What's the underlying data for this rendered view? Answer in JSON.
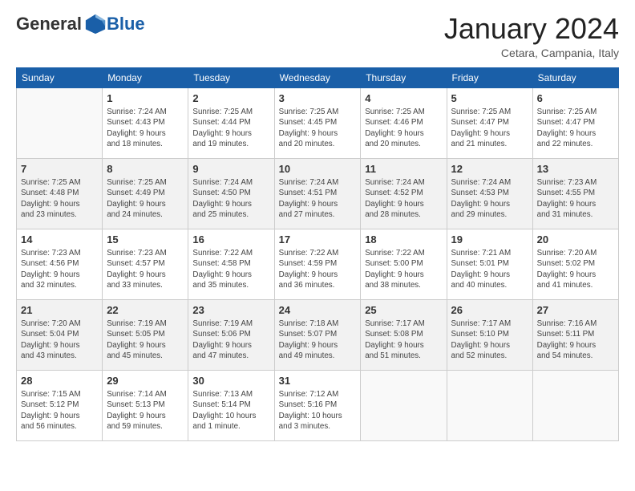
{
  "header": {
    "logo_general": "General",
    "logo_blue": "Blue",
    "month_title": "January 2024",
    "location": "Cetara, Campania, Italy"
  },
  "weekdays": [
    "Sunday",
    "Monday",
    "Tuesday",
    "Wednesday",
    "Thursday",
    "Friday",
    "Saturday"
  ],
  "rows": [
    [
      {
        "day": "",
        "info": ""
      },
      {
        "day": "1",
        "info": "Sunrise: 7:24 AM\nSunset: 4:43 PM\nDaylight: 9 hours\nand 18 minutes."
      },
      {
        "day": "2",
        "info": "Sunrise: 7:25 AM\nSunset: 4:44 PM\nDaylight: 9 hours\nand 19 minutes."
      },
      {
        "day": "3",
        "info": "Sunrise: 7:25 AM\nSunset: 4:45 PM\nDaylight: 9 hours\nand 20 minutes."
      },
      {
        "day": "4",
        "info": "Sunrise: 7:25 AM\nSunset: 4:46 PM\nDaylight: 9 hours\nand 20 minutes."
      },
      {
        "day": "5",
        "info": "Sunrise: 7:25 AM\nSunset: 4:47 PM\nDaylight: 9 hours\nand 21 minutes."
      },
      {
        "day": "6",
        "info": "Sunrise: 7:25 AM\nSunset: 4:47 PM\nDaylight: 9 hours\nand 22 minutes."
      }
    ],
    [
      {
        "day": "7",
        "info": "Sunrise: 7:25 AM\nSunset: 4:48 PM\nDaylight: 9 hours\nand 23 minutes."
      },
      {
        "day": "8",
        "info": "Sunrise: 7:25 AM\nSunset: 4:49 PM\nDaylight: 9 hours\nand 24 minutes."
      },
      {
        "day": "9",
        "info": "Sunrise: 7:24 AM\nSunset: 4:50 PM\nDaylight: 9 hours\nand 25 minutes."
      },
      {
        "day": "10",
        "info": "Sunrise: 7:24 AM\nSunset: 4:51 PM\nDaylight: 9 hours\nand 27 minutes."
      },
      {
        "day": "11",
        "info": "Sunrise: 7:24 AM\nSunset: 4:52 PM\nDaylight: 9 hours\nand 28 minutes."
      },
      {
        "day": "12",
        "info": "Sunrise: 7:24 AM\nSunset: 4:53 PM\nDaylight: 9 hours\nand 29 minutes."
      },
      {
        "day": "13",
        "info": "Sunrise: 7:23 AM\nSunset: 4:55 PM\nDaylight: 9 hours\nand 31 minutes."
      }
    ],
    [
      {
        "day": "14",
        "info": "Sunrise: 7:23 AM\nSunset: 4:56 PM\nDaylight: 9 hours\nand 32 minutes."
      },
      {
        "day": "15",
        "info": "Sunrise: 7:23 AM\nSunset: 4:57 PM\nDaylight: 9 hours\nand 33 minutes."
      },
      {
        "day": "16",
        "info": "Sunrise: 7:22 AM\nSunset: 4:58 PM\nDaylight: 9 hours\nand 35 minutes."
      },
      {
        "day": "17",
        "info": "Sunrise: 7:22 AM\nSunset: 4:59 PM\nDaylight: 9 hours\nand 36 minutes."
      },
      {
        "day": "18",
        "info": "Sunrise: 7:22 AM\nSunset: 5:00 PM\nDaylight: 9 hours\nand 38 minutes."
      },
      {
        "day": "19",
        "info": "Sunrise: 7:21 AM\nSunset: 5:01 PM\nDaylight: 9 hours\nand 40 minutes."
      },
      {
        "day": "20",
        "info": "Sunrise: 7:20 AM\nSunset: 5:02 PM\nDaylight: 9 hours\nand 41 minutes."
      }
    ],
    [
      {
        "day": "21",
        "info": "Sunrise: 7:20 AM\nSunset: 5:04 PM\nDaylight: 9 hours\nand 43 minutes."
      },
      {
        "day": "22",
        "info": "Sunrise: 7:19 AM\nSunset: 5:05 PM\nDaylight: 9 hours\nand 45 minutes."
      },
      {
        "day": "23",
        "info": "Sunrise: 7:19 AM\nSunset: 5:06 PM\nDaylight: 9 hours\nand 47 minutes."
      },
      {
        "day": "24",
        "info": "Sunrise: 7:18 AM\nSunset: 5:07 PM\nDaylight: 9 hours\nand 49 minutes."
      },
      {
        "day": "25",
        "info": "Sunrise: 7:17 AM\nSunset: 5:08 PM\nDaylight: 9 hours\nand 51 minutes."
      },
      {
        "day": "26",
        "info": "Sunrise: 7:17 AM\nSunset: 5:10 PM\nDaylight: 9 hours\nand 52 minutes."
      },
      {
        "day": "27",
        "info": "Sunrise: 7:16 AM\nSunset: 5:11 PM\nDaylight: 9 hours\nand 54 minutes."
      }
    ],
    [
      {
        "day": "28",
        "info": "Sunrise: 7:15 AM\nSunset: 5:12 PM\nDaylight: 9 hours\nand 56 minutes."
      },
      {
        "day": "29",
        "info": "Sunrise: 7:14 AM\nSunset: 5:13 PM\nDaylight: 9 hours\nand 59 minutes."
      },
      {
        "day": "30",
        "info": "Sunrise: 7:13 AM\nSunset: 5:14 PM\nDaylight: 10 hours\nand 1 minute."
      },
      {
        "day": "31",
        "info": "Sunrise: 7:12 AM\nSunset: 5:16 PM\nDaylight: 10 hours\nand 3 minutes."
      },
      {
        "day": "",
        "info": ""
      },
      {
        "day": "",
        "info": ""
      },
      {
        "day": "",
        "info": ""
      }
    ]
  ]
}
